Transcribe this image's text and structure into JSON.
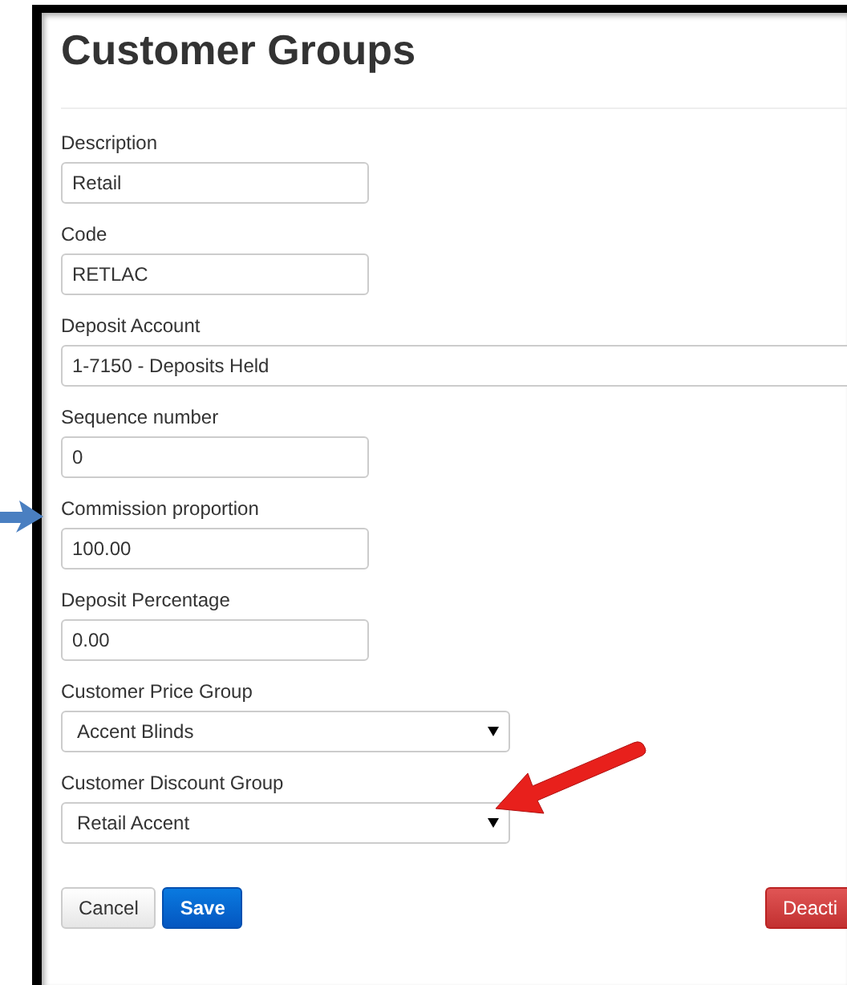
{
  "title": "Customer Groups",
  "fields": [
    {
      "kind": "short",
      "label": "Description",
      "value": "Retail"
    },
    {
      "kind": "short",
      "label": "Code",
      "value": "RETLAC"
    },
    {
      "kind": "wide",
      "label": "Deposit Account",
      "value": "1-7150 - Deposits Held"
    },
    {
      "kind": "short",
      "label": "Sequence number",
      "value": "0"
    },
    {
      "kind": "short",
      "label": "Commission proportion",
      "value": "100.00"
    },
    {
      "kind": "short",
      "label": "Deposit Percentage",
      "value": "0.00"
    },
    {
      "kind": "select",
      "label": "Customer Price Group",
      "value": "Accent Blinds"
    },
    {
      "kind": "select",
      "label": "Customer Discount Group",
      "value": "Retail Accent"
    }
  ],
  "buttons": [
    {
      "kind": "default",
      "label": "Cancel"
    },
    {
      "kind": "primary",
      "label": "Save"
    },
    {
      "kind": "danger",
      "label": "Deacti"
    }
  ]
}
